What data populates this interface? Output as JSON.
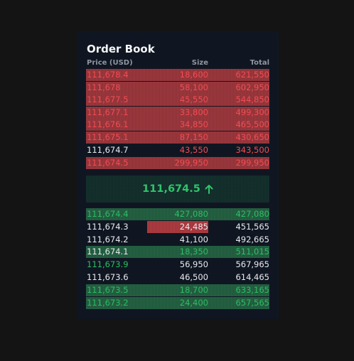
{
  "title": "Order Book",
  "columns": {
    "price": "Price (USD)",
    "size": "Size",
    "total": "Total"
  },
  "asks": [
    {
      "price": "111,678.4",
      "size": "18,600",
      "total": "621,550",
      "depth": 1.0
    },
    {
      "price": "111,678",
      "size": "58,100",
      "total": "602,950",
      "depth": 1.0
    },
    {
      "price": "111,677.5",
      "size": "45,550",
      "total": "544,850",
      "depth": 1.0
    },
    {
      "price": "111,677.1",
      "size": "33,800",
      "total": "499,300",
      "depth": 1.0
    },
    {
      "price": "111,676.1",
      "size": "34,850",
      "total": "465,500",
      "depth": 1.0
    },
    {
      "price": "111,675.1",
      "size": "87,150",
      "total": "430,650",
      "depth": 1.0
    },
    {
      "price": "111,674.7",
      "size": "43,550",
      "total": "343,500",
      "depth": 0
    },
    {
      "price": "111,674.5",
      "size": "299,950",
      "total": "299,950",
      "depth": 1.0
    }
  ],
  "mid": {
    "price": "111,674.5",
    "icon": "arrow-up-icon",
    "color": "#2ec46a"
  },
  "bids": [
    {
      "price": "111,674.4",
      "size": "427,080",
      "total": "427,080",
      "depth": 1.0
    },
    {
      "price": "111,674.3",
      "size": "24,485",
      "total": "451,565",
      "depth": 0
    },
    {
      "price": "111,674.2",
      "size": "41,100",
      "total": "492,665",
      "depth": 0
    },
    {
      "price": "111,674.1",
      "size": "18,350",
      "total": "511,015",
      "depth": 1.0
    },
    {
      "price": "111,673.9",
      "size": "56,950",
      "total": "567,965",
      "depth": 0
    },
    {
      "price": "111,673.6",
      "size": "46,500",
      "total": "614,465",
      "depth": 0
    },
    {
      "price": "111,673.5",
      "size": "18,700",
      "total": "633,165",
      "depth": 1.0
    },
    {
      "price": "111,673.2",
      "size": "24,400",
      "total": "657,565",
      "depth": 1.0
    }
  ],
  "colors": {
    "ask": "#ef4d52",
    "bid": "#2cbd63",
    "background": "#101621"
  }
}
